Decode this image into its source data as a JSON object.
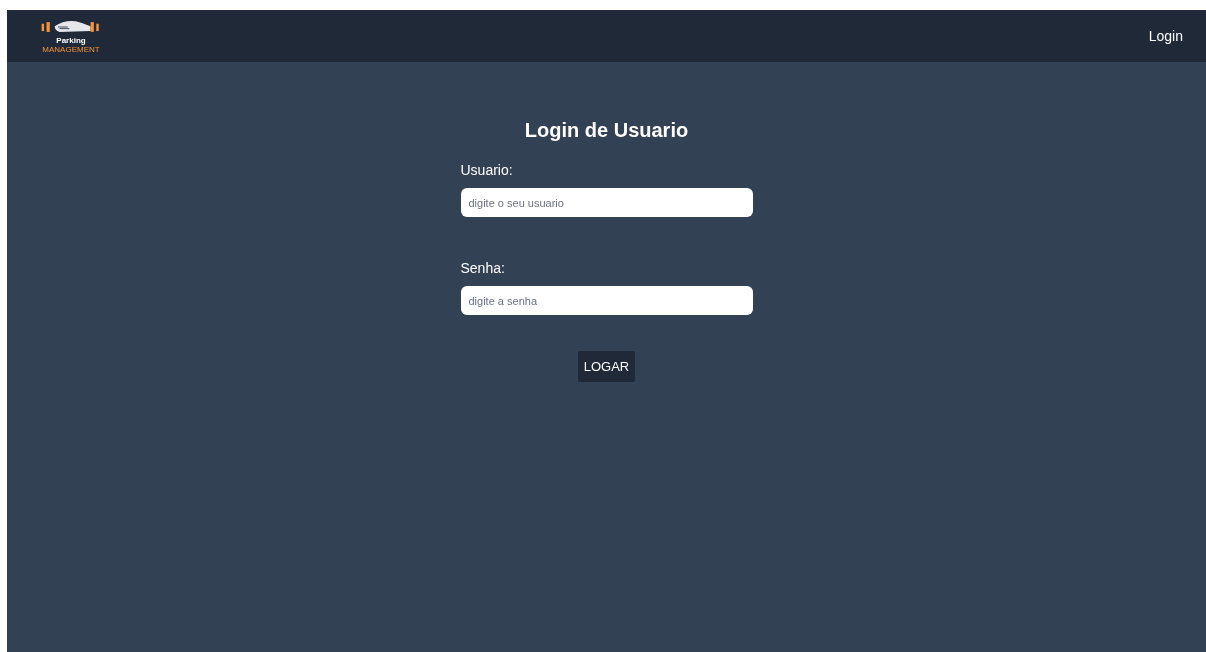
{
  "navbar": {
    "logo": {
      "line_1": "Parking",
      "line_2": "MANAGEMENT"
    },
    "link": "Login"
  },
  "form": {
    "title": "Login de Usuario",
    "fields": [
      {
        "label": "Usuario:",
        "placeholder": "digite o seu usuario"
      },
      {
        "label": "Senha:",
        "placeholder": "digite a senha"
      }
    ],
    "button": "LOGAR"
  }
}
